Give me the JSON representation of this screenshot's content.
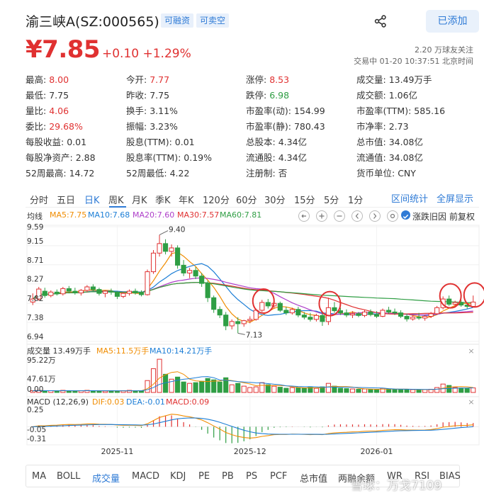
{
  "header": {
    "title": "渝三峡A(SZ:000565)",
    "tags": [
      "可融资",
      "可卖空"
    ],
    "added_label": "已添加",
    "price": "¥7.85",
    "change": "+0.10 +1.29%",
    "fans": "2.20 万球友关注",
    "status": "交易中 01-20 10:37:51 北京时间"
  },
  "quotes": [
    [
      {
        "k": "最高:",
        "v": "8.00",
        "c": "red"
      },
      {
        "k": "今开:",
        "v": "7.77",
        "c": "red"
      },
      {
        "k": "涨停:",
        "v": "8.53",
        "c": "red"
      },
      {
        "k": "成交量:",
        "v": "13.49万手",
        "c": ""
      }
    ],
    [
      {
        "k": "最低:",
        "v": "7.75",
        "c": ""
      },
      {
        "k": "昨收:",
        "v": "7.75",
        "c": ""
      },
      {
        "k": "跌停:",
        "v": "6.98",
        "c": "green"
      },
      {
        "k": "成交额:",
        "v": "1.06亿",
        "c": ""
      }
    ],
    [
      {
        "k": "量比:",
        "v": "4.06",
        "c": "red"
      },
      {
        "k": "换手:",
        "v": "3.11%",
        "c": ""
      },
      {
        "k": "市盈率(动):",
        "v": "154.99",
        "c": ""
      },
      {
        "k": "市盈率(TTM):",
        "v": "585.16",
        "c": ""
      }
    ],
    [
      {
        "k": "委比:",
        "v": "29.68%",
        "c": "red"
      },
      {
        "k": "振幅:",
        "v": "3.23%",
        "c": ""
      },
      {
        "k": "市盈率(静):",
        "v": "780.43",
        "c": ""
      },
      {
        "k": "市净率:",
        "v": "2.73",
        "c": ""
      }
    ],
    [
      {
        "k": "每股收益:",
        "v": "0.01",
        "c": ""
      },
      {
        "k": "股息(TTM):",
        "v": "0.01",
        "c": ""
      },
      {
        "k": "总股本:",
        "v": "4.34亿",
        "c": ""
      },
      {
        "k": "总市值:",
        "v": "34.08亿",
        "c": ""
      }
    ],
    [
      {
        "k": "每股净资产:",
        "v": "2.88",
        "c": ""
      },
      {
        "k": "股息率(TTM):",
        "v": "0.19%",
        "c": ""
      },
      {
        "k": "流通股:",
        "v": "4.34亿",
        "c": ""
      },
      {
        "k": "流通值:",
        "v": "34.08亿",
        "c": ""
      }
    ],
    [
      {
        "k": "52周最高:",
        "v": "14.72",
        "c": ""
      },
      {
        "k": "52周最低:",
        "v": "4.22",
        "c": ""
      },
      {
        "k": "注册制:",
        "v": "否",
        "c": ""
      },
      {
        "k": "货币单位:",
        "v": "CNY",
        "c": ""
      }
    ]
  ],
  "period_tabs": [
    "分时",
    "五日",
    "日K",
    "周K",
    "月K",
    "季K",
    "年K",
    "120分",
    "60分",
    "30分",
    "15分",
    "5分",
    "1分"
  ],
  "active_period": "日K",
  "chart_tools": [
    "区间统计",
    "全屏显示"
  ],
  "chart_options": {
    "checkbox_label": "涨跌旧因",
    "right_label": "前复权"
  },
  "chart_data": {
    "type": "candlestick",
    "ma_legend": {
      "label": "均线",
      "items": [
        {
          "name": "MA5:7.75",
          "color": "#f08c00"
        },
        {
          "name": "MA10:7.68",
          "color": "#1c7ed6"
        },
        {
          "name": "MA20:7.60",
          "color": "#ae3ec9"
        },
        {
          "name": "MA30:7.57",
          "color": "#e03131"
        },
        {
          "name": "MA60:7.81",
          "color": "#2f9e44"
        }
      ]
    },
    "y_ticks": [
      "9.59",
      "9.15",
      "8.71",
      "8.27",
      "7.82",
      "7.38",
      "6.94"
    ],
    "y_range": [
      6.94,
      9.59
    ],
    "annotations": {
      "high": "9.40",
      "low": "7.13"
    },
    "x_ticks": [
      "2025-11",
      "2025-12",
      "2026-01"
    ],
    "candles": [
      [
        7.85,
        8.05,
        7.78,
        7.92
      ],
      [
        7.92,
        8.2,
        7.88,
        8.15
      ],
      [
        8.1,
        8.18,
        7.95,
        8.0
      ],
      [
        8.0,
        8.12,
        7.96,
        8.08
      ],
      [
        8.08,
        8.14,
        8.0,
        8.04
      ],
      [
        8.04,
        8.2,
        8.0,
        8.16
      ],
      [
        8.16,
        8.22,
        8.05,
        8.1
      ],
      [
        8.1,
        8.18,
        8.02,
        8.06
      ],
      [
        8.06,
        8.15,
        8.0,
        8.12
      ],
      [
        8.12,
        8.24,
        8.08,
        8.2
      ],
      [
        8.2,
        8.26,
        8.08,
        8.14
      ],
      [
        8.14,
        8.18,
        8.0,
        8.05
      ],
      [
        8.05,
        8.12,
        7.96,
        8.1
      ],
      [
        8.1,
        8.16,
        8.02,
        8.08
      ],
      [
        8.08,
        8.1,
        7.92,
        7.98
      ],
      [
        7.98,
        8.08,
        7.94,
        8.05
      ],
      [
        8.05,
        8.14,
        8.0,
        8.1
      ],
      [
        8.1,
        8.16,
        8.02,
        8.06
      ],
      [
        8.06,
        8.12,
        7.98,
        8.02
      ],
      [
        8.02,
        8.6,
        8.0,
        8.55
      ],
      [
        8.55,
        9.05,
        8.5,
        8.98
      ],
      [
        8.98,
        9.4,
        8.9,
        9.2
      ],
      [
        9.2,
        9.3,
        8.95,
        9.02
      ],
      [
        9.02,
        9.18,
        8.9,
        9.1
      ],
      [
        9.1,
        9.16,
        8.62,
        8.7
      ],
      [
        8.7,
        8.82,
        8.45,
        8.52
      ],
      [
        8.52,
        8.64,
        8.4,
        8.58
      ],
      [
        8.58,
        8.66,
        8.38,
        8.45
      ],
      [
        8.45,
        8.52,
        8.2,
        8.28
      ],
      [
        8.28,
        8.34,
        7.85,
        7.95
      ],
      [
        7.95,
        8.0,
        7.6,
        7.68
      ],
      [
        7.68,
        7.75,
        7.48,
        7.55
      ],
      [
        7.55,
        7.62,
        7.2,
        7.3
      ],
      [
        7.3,
        7.45,
        7.22,
        7.4
      ],
      [
        7.4,
        7.5,
        7.13,
        7.35
      ],
      [
        7.35,
        7.44,
        7.28,
        7.42
      ],
      [
        7.42,
        7.52,
        7.36,
        7.45
      ],
      [
        7.45,
        7.7,
        7.42,
        7.66
      ],
      [
        7.66,
        7.9,
        7.62,
        7.84
      ],
      [
        7.84,
        7.92,
        7.7,
        7.76
      ],
      [
        7.76,
        7.88,
        7.7,
        7.82
      ],
      [
        7.82,
        7.86,
        7.62,
        7.66
      ],
      [
        7.66,
        7.74,
        7.55,
        7.6
      ],
      [
        7.6,
        7.72,
        7.56,
        7.68
      ],
      [
        7.68,
        7.74,
        7.5,
        7.55
      ],
      [
        7.55,
        7.62,
        7.45,
        7.5
      ],
      [
        7.5,
        7.6,
        7.4,
        7.45
      ],
      [
        7.45,
        7.58,
        7.4,
        7.54
      ],
      [
        7.54,
        7.62,
        7.3,
        7.4
      ],
      [
        7.4,
        7.95,
        7.32,
        7.72
      ],
      [
        7.72,
        7.85,
        7.6,
        7.65
      ],
      [
        7.65,
        7.72,
        7.55,
        7.6
      ],
      [
        7.6,
        7.68,
        7.5,
        7.55
      ],
      [
        7.55,
        7.64,
        7.48,
        7.58
      ],
      [
        7.58,
        7.62,
        7.5,
        7.54
      ],
      [
        7.54,
        7.66,
        7.5,
        7.62
      ],
      [
        7.62,
        7.68,
        7.52,
        7.56
      ],
      [
        7.56,
        7.64,
        7.48,
        7.52
      ],
      [
        7.52,
        7.7,
        7.5,
        7.66
      ],
      [
        7.66,
        7.74,
        7.58,
        7.62
      ],
      [
        7.62,
        7.7,
        7.55,
        7.6
      ],
      [
        7.6,
        7.66,
        7.48,
        7.52
      ],
      [
        7.52,
        7.58,
        7.4,
        7.46
      ],
      [
        7.46,
        7.55,
        7.42,
        7.5
      ],
      [
        7.5,
        7.6,
        7.44,
        7.48
      ],
      [
        7.48,
        7.56,
        7.42,
        7.52
      ],
      [
        7.52,
        7.62,
        7.48,
        7.58
      ],
      [
        7.58,
        7.76,
        7.55,
        7.72
      ],
      [
        7.72,
        7.98,
        7.68,
        7.92
      ],
      [
        7.92,
        8.0,
        7.76,
        7.8
      ],
      [
        7.8,
        7.88,
        7.72,
        7.84
      ],
      [
        7.84,
        7.9,
        7.74,
        7.78
      ],
      [
        7.78,
        7.84,
        7.7,
        7.75
      ],
      [
        7.75,
        8.0,
        7.75,
        7.85
      ]
    ],
    "volume_label": "成交量 13.49万手",
    "volume_ma": [
      {
        "name": "MA5:11.5万手",
        "color": "#f08c00"
      },
      {
        "name": "MA10:14.21万手",
        "color": "#1c7ed6"
      }
    ],
    "volume_ticks": [
      "95.22万",
      "47.61万",
      "0.00"
    ],
    "volume": [
      5,
      6,
      4,
      5,
      4,
      6,
      5,
      4,
      5,
      6,
      5,
      4,
      4,
      5,
      4,
      5,
      6,
      4,
      5,
      34,
      68,
      95,
      52,
      38,
      44,
      30,
      26,
      28,
      32,
      40,
      36,
      30,
      42,
      22,
      26,
      18,
      14,
      16,
      28,
      22,
      18,
      15,
      12,
      14,
      13,
      12,
      15,
      12,
      16,
      26,
      18,
      12,
      11,
      10,
      9,
      10,
      9,
      8,
      12,
      10,
      9,
      8,
      9,
      8,
      7,
      8,
      9,
      14,
      24,
      20,
      14,
      12,
      11,
      13
    ],
    "macd_label": "MACD (12,26,9)",
    "macd_legend": [
      {
        "name": "DIF:0.03",
        "color": "#f08c00"
      },
      {
        "name": "DEA:-0.01",
        "color": "#1c7ed6"
      },
      {
        "name": "MACD:0.09",
        "color": "#e03131"
      }
    ],
    "macd_ticks": [
      "0.25",
      "-0.05",
      "-0.31"
    ],
    "macd_range": [
      -0.31,
      0.25
    ]
  },
  "bottom_tabs": [
    "MA",
    "BOLL",
    "成交量",
    "MACD",
    "KDJ",
    "PE",
    "PB",
    "PS",
    "PCF",
    "总市值",
    "两融余额",
    "WR",
    "RSI",
    "BIAS"
  ],
  "active_indicator": "成交量",
  "watermark": "雪球：万戈7109"
}
